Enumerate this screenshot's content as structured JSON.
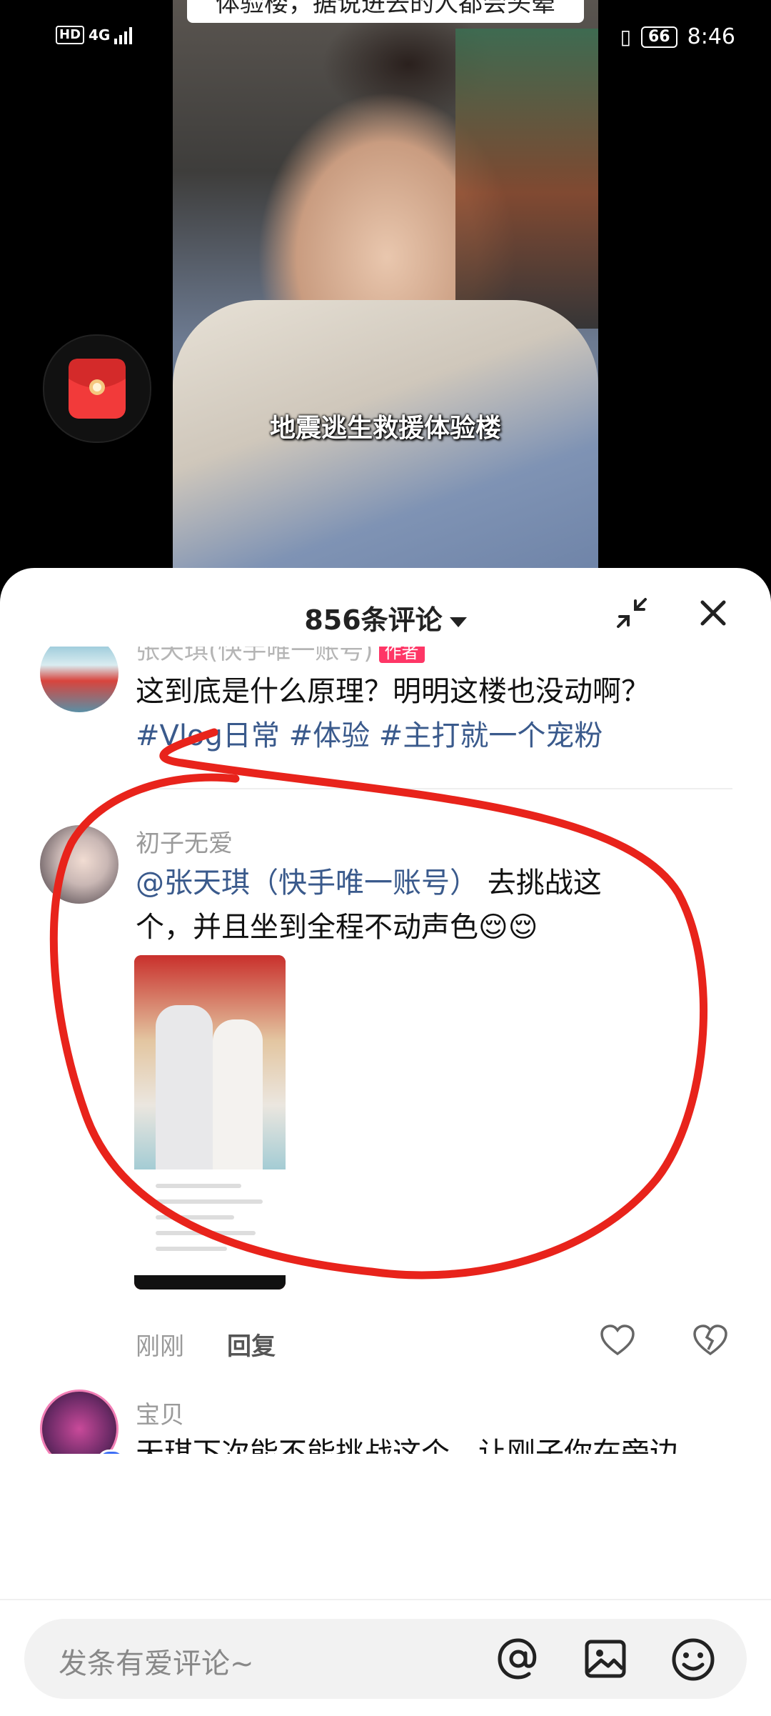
{
  "status_bar": {
    "network_hd": "HD",
    "network_type": "4G",
    "battery": "66",
    "time": "8:46"
  },
  "video": {
    "caption": "地震逃生救援体验楼",
    "top_caption_partial": "体验楼，据说进去的人都会头晕"
  },
  "comments_header": {
    "count_label": "856条评论"
  },
  "comments": [
    {
      "name": "张天琪(快手唯一账号)",
      "author_badge": "作者",
      "text": "这到底是什么原理？明明这楼也没动啊？",
      "tags": "#Vlog日常 #体验 #主打就一个宠粉"
    },
    {
      "name": "初子无爱",
      "mention": "@张天琪（快手唯一账号）",
      "text_line1_rest": " 去挑战这",
      "text_line2": "个，并且坐到全程不动声色😌😌",
      "time": "刚刚",
      "reply_label": "回复"
    },
    {
      "name": "宝贝",
      "text": "天琪下次能不能挑战这个，让刚子你在旁边"
    }
  ],
  "input_bar": {
    "placeholder": "发条有爱评论~"
  },
  "colors": {
    "accent_link": "#3a5a8c",
    "author_badge": "#fe3666",
    "annotation": "#e8231b"
  }
}
